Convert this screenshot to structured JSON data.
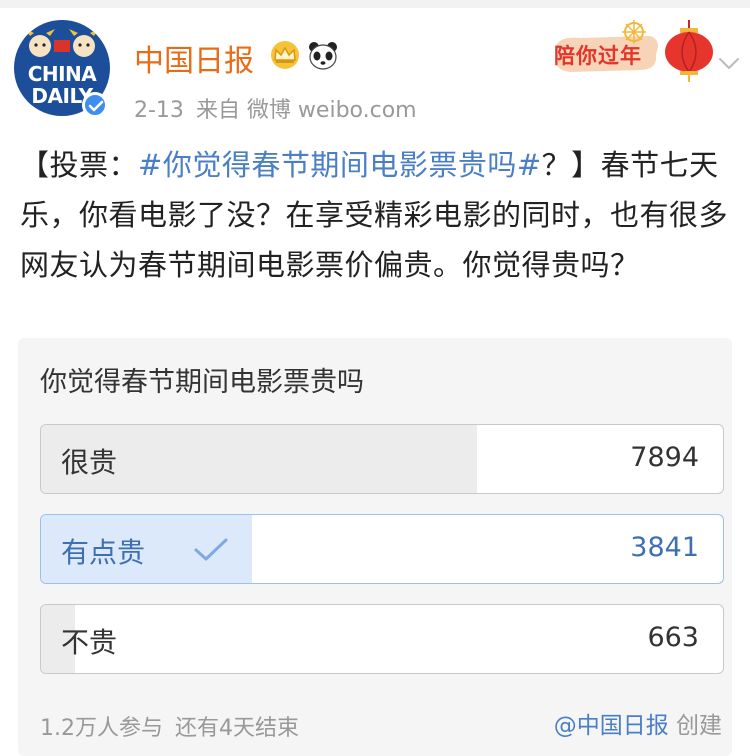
{
  "header": {
    "avatar_line1": "CHINA",
    "avatar_line2": "DAILY",
    "username": "中国日报",
    "time": "2-13",
    "source": "来自 微博 weibo.com",
    "banner_text": "陪你过年"
  },
  "post": {
    "prefix": "【投票：",
    "topic": "#你觉得春节期间电影票贵吗#",
    "body": "？】春节七天乐，你看电影了没？在享受精彩电影的同时，也有很多网友认为春节期间电影票价偏贵。你觉得贵吗？"
  },
  "poll": {
    "question": "你觉得春节期间电影票贵吗",
    "options": [
      {
        "label": "很贵",
        "count": "7894",
        "share": 0.64,
        "selected": false
      },
      {
        "label": "有点贵",
        "count": "3841",
        "share": 0.31,
        "selected": true
      },
      {
        "label": "不贵",
        "count": "663",
        "share": 0.05,
        "selected": false
      }
    ],
    "participants": "1.2万人参与",
    "remaining": "还有4天结束",
    "creator_link": "@中国日报",
    "creator_suffix": "创建"
  },
  "colors": {
    "username": "#e86c17",
    "link": "#4a7fc6",
    "selected_fill": "#dbe9fb"
  },
  "icons": [
    "crown-icon",
    "panda-icon",
    "verified-icon",
    "lantern-icon",
    "chevron-down-icon",
    "check-icon"
  ]
}
